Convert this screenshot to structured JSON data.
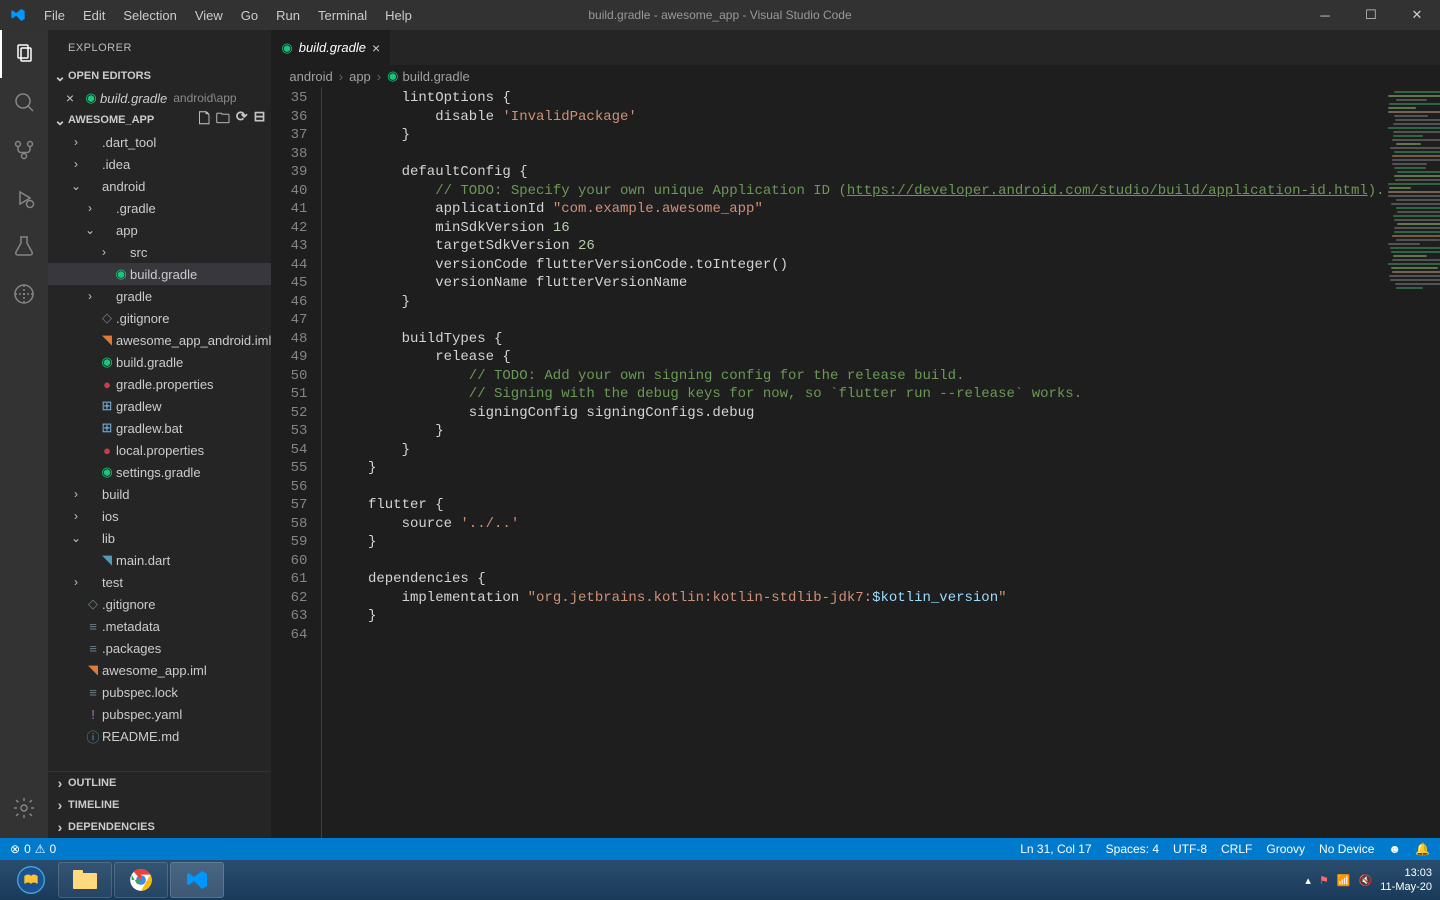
{
  "titlebar": {
    "title": "build.gradle - awesome_app - Visual Studio Code",
    "menu": [
      "File",
      "Edit",
      "Selection",
      "View",
      "Go",
      "Run",
      "Terminal",
      "Help"
    ]
  },
  "sidebar": {
    "title": "EXPLORER",
    "openEditors": "OPEN EDITORS",
    "project": "AWESOME_APP",
    "outline": "OUTLINE",
    "timeline": "TIMELINE",
    "dependencies": "DEPENDENCIES",
    "editorTab": {
      "name": "build.gradle",
      "meta": "android\\app"
    },
    "tree": [
      {
        "indent": 1,
        "chev": "›",
        "icon": "",
        "cls": "",
        "label": ".dart_tool"
      },
      {
        "indent": 1,
        "chev": "›",
        "icon": "",
        "cls": "",
        "label": ".idea"
      },
      {
        "indent": 1,
        "chev": "⌄",
        "icon": "",
        "cls": "",
        "label": "android"
      },
      {
        "indent": 2,
        "chev": "›",
        "icon": "",
        "cls": "",
        "label": ".gradle"
      },
      {
        "indent": 2,
        "chev": "⌄",
        "icon": "",
        "cls": "",
        "label": "app"
      },
      {
        "indent": 3,
        "chev": "›",
        "icon": "",
        "cls": "",
        "label": "src"
      },
      {
        "indent": 3,
        "chev": "",
        "icon": "◉",
        "cls": "ic-gradle",
        "label": "build.gradle",
        "active": true
      },
      {
        "indent": 2,
        "chev": "›",
        "icon": "",
        "cls": "",
        "label": "gradle"
      },
      {
        "indent": 2,
        "chev": "",
        "icon": "◇",
        "cls": "ic-gray",
        "label": ".gitignore"
      },
      {
        "indent": 2,
        "chev": "",
        "icon": "◥",
        "cls": "ic-orange",
        "label": "awesome_app_android.iml"
      },
      {
        "indent": 2,
        "chev": "",
        "icon": "◉",
        "cls": "ic-gradle",
        "label": "build.gradle"
      },
      {
        "indent": 2,
        "chev": "",
        "icon": "●",
        "cls": "ic-red",
        "label": "gradle.properties"
      },
      {
        "indent": 2,
        "chev": "",
        "icon": "⊞",
        "cls": "ic-lightblue",
        "label": "gradlew"
      },
      {
        "indent": 2,
        "chev": "",
        "icon": "⊞",
        "cls": "ic-lightblue",
        "label": "gradlew.bat"
      },
      {
        "indent": 2,
        "chev": "",
        "icon": "●",
        "cls": "ic-red",
        "label": "local.properties"
      },
      {
        "indent": 2,
        "chev": "",
        "icon": "◉",
        "cls": "ic-gradle",
        "label": "settings.gradle"
      },
      {
        "indent": 1,
        "chev": "›",
        "icon": "",
        "cls": "",
        "label": "build"
      },
      {
        "indent": 1,
        "chev": "›",
        "icon": "",
        "cls": "",
        "label": "ios"
      },
      {
        "indent": 1,
        "chev": "⌄",
        "icon": "",
        "cls": "",
        "label": "lib"
      },
      {
        "indent": 2,
        "chev": "",
        "icon": "◥",
        "cls": "ic-blue",
        "label": "main.dart"
      },
      {
        "indent": 1,
        "chev": "›",
        "icon": "",
        "cls": "",
        "label": "test"
      },
      {
        "indent": 1,
        "chev": "",
        "icon": "◇",
        "cls": "ic-gray",
        "label": ".gitignore"
      },
      {
        "indent": 1,
        "chev": "",
        "icon": "≡",
        "cls": "ic-gray",
        "label": ".metadata"
      },
      {
        "indent": 1,
        "chev": "",
        "icon": "≡",
        "cls": "ic-gray",
        "label": ".packages"
      },
      {
        "indent": 1,
        "chev": "",
        "icon": "◥",
        "cls": "ic-orange",
        "label": "awesome_app.iml"
      },
      {
        "indent": 1,
        "chev": "",
        "icon": "≡",
        "cls": "ic-gray",
        "label": "pubspec.lock"
      },
      {
        "indent": 1,
        "chev": "",
        "icon": "!",
        "cls": "ic-purple",
        "label": "pubspec.yaml"
      },
      {
        "indent": 1,
        "chev": "",
        "icon": "ⓘ",
        "cls": "ic-blue",
        "label": "README.md"
      }
    ]
  },
  "tab": {
    "name": "build.gradle"
  },
  "breadcrumbs": [
    "android",
    "app",
    "build.gradle"
  ],
  "code": {
    "start": 35,
    "lines": [
      "        lintOptions {",
      "            disable <span class='tok-str'>'InvalidPackage'</span>",
      "        }",
      "",
      "        defaultConfig {",
      "            <span class='tok-com'>// TODO: Specify your own unique Application ID (</span><span class='tok-url'>https://developer.android.com/studio/build/application-id.html</span><span class='tok-com'>).</span>",
      "            applicationId <span class='tok-str'>\"com.example.awesome_app\"</span>",
      "            minSdkVersion <span class='tok-num'>16</span>",
      "            targetSdkVersion <span class='tok-num'>26</span>",
      "            versionCode flutterVersionCode.toInteger()",
      "            versionName flutterVersionName",
      "        }",
      "",
      "        buildTypes {",
      "            release {",
      "                <span class='tok-com'>// TODO: Add your own signing config for the release build.</span>",
      "                <span class='tok-com'>// Signing with the debug keys for now, so `flutter run --release` works.</span>",
      "                signingConfig signingConfigs.debug",
      "            }",
      "        }",
      "    }",
      "",
      "    flutter {",
      "        source <span class='tok-str'>'../..'</span>",
      "    }",
      "",
      "    dependencies {",
      "        implementation <span class='tok-str'>\"org.jetbrains.kotlin:kotlin-stdlib-jdk7:</span><span class='tok-var'>$kotlin_version</span><span class='tok-str'>\"</span>",
      "    }",
      ""
    ]
  },
  "statusbar": {
    "errors": "0",
    "warnings": "0",
    "position": "Ln 31, Col 17",
    "spaces": "Spaces: 4",
    "encoding": "UTF-8",
    "eol": "CRLF",
    "lang": "Groovy",
    "device": "No Device"
  },
  "taskbar": {
    "time": "13:03",
    "date": "11-May-20"
  }
}
